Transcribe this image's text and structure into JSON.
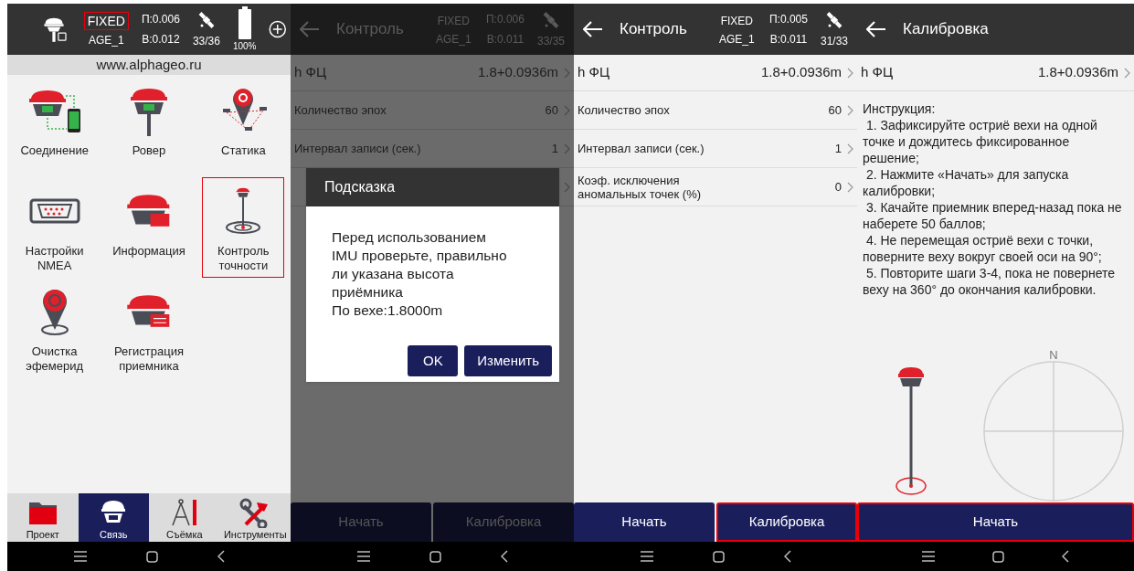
{
  "menu_screen": {
    "status": {
      "fix": "FIXED",
      "fix_highlighted": true,
      "age": "AGE_1",
      "p": "П:0.006",
      "b": "B:0.012",
      "sats": "33/36",
      "battery": "100%"
    },
    "website": "www.alphageo.ru",
    "items": [
      {
        "label": "Соединение",
        "selected": false
      },
      {
        "label": "Ровер",
        "selected": false
      },
      {
        "label": "Статика",
        "selected": false
      },
      {
        "label": "Настройки\nNMEA",
        "selected": false
      },
      {
        "label": "Информация",
        "selected": false
      },
      {
        "label": "Контроль\nточности",
        "selected": true
      },
      {
        "label": "Очистка\nэфемерид",
        "selected": false
      },
      {
        "label": "Регистрация\nприемника",
        "selected": false
      }
    ],
    "tabs": [
      {
        "label": "Проект",
        "selected": false
      },
      {
        "label": "Связь",
        "selected": true
      },
      {
        "label": "Съёмка",
        "selected": false
      },
      {
        "label": "Инструменты",
        "selected": false
      }
    ]
  },
  "accuracy_screen_with_dialog": {
    "title": "Контроль",
    "status": {
      "fix": "FIXED",
      "fix_highlighted": false,
      "age": "AGE_1",
      "p": "П:0.006",
      "b": "B:0.011",
      "sats": "33/35"
    },
    "rows": [
      {
        "label": "h ФЦ",
        "value": "1.8+0.0936m"
      },
      {
        "label": "Количество эпох",
        "value": "60"
      },
      {
        "label": "Интервал записи (сек.)",
        "value": "1"
      }
    ],
    "buttons": [
      {
        "label": "Начать",
        "selected": false
      },
      {
        "label": "Калибровка",
        "selected": false
      }
    ],
    "dialog": {
      "title": "Подсказка",
      "message": "Перед использованием\nIMU проверьте, правильно\nли указана высота\nприёмника\nПо вехе:1.8000m",
      "buttons": [
        "OK",
        "Изменить"
      ]
    }
  },
  "accuracy_screen": {
    "title": "Контроль",
    "status": {
      "fix": "FIXED",
      "fix_highlighted": false,
      "age": "AGE_1",
      "p": "П:0.005",
      "b": "B:0.011",
      "sats": "31/33"
    },
    "rows": [
      {
        "label": "h ФЦ",
        "value": "1.8+0.0936m"
      },
      {
        "label": "Количество эпох",
        "value": "60"
      },
      {
        "label": "Интервал записи (сек.)",
        "value": "1"
      },
      {
        "label": "Коэф. исключения\nаномальных точек (%)",
        "value": "0"
      }
    ],
    "buttons": [
      {
        "label": "Начать",
        "selected": false
      },
      {
        "label": "Калибровка",
        "selected": true
      }
    ]
  },
  "calibration_screen": {
    "title": "Калибровка",
    "rows": [
      {
        "label": "h ФЦ",
        "value": "1.8+0.0936m"
      }
    ],
    "instructions": [
      "Инструкция:",
      " 1. Зафиксируйте остриё вехи на одной точке и дождитесь фиксированное решение;",
      " 2. Нажмите «Начать» для запуска калибровки;",
      " 3. Качайте приемник вперед-назад пока не наберете 50 баллов;",
      " 4. Не перемещая остриё вехи с точки, поверните веху вокруг своей оси на 90°;",
      " 5. Повторите шаги 3-4, пока не повернете веху на 360° до окончания калибровки."
    ],
    "compass_label": "N",
    "buttons": [
      {
        "label": "Начать",
        "selected": true
      }
    ]
  }
}
